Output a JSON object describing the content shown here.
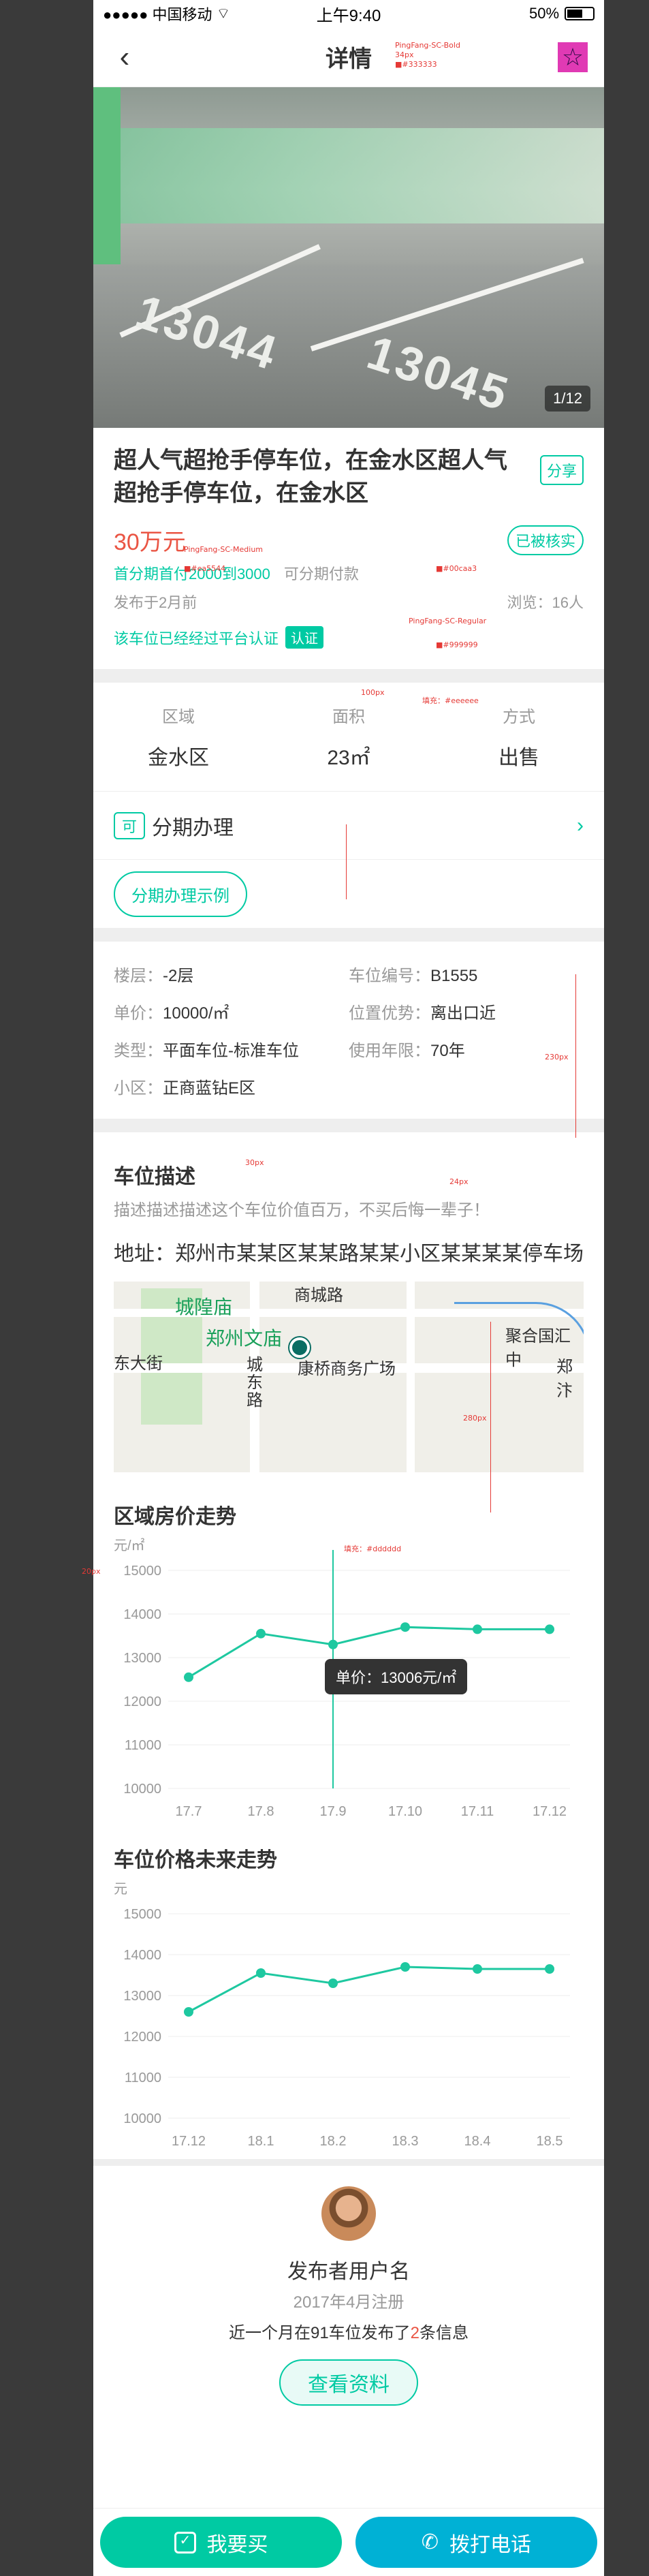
{
  "status_bar": {
    "carrier": "●●●●● 中国移动",
    "time": "上午9:40",
    "battery": "50%"
  },
  "nav": {
    "title": "详情"
  },
  "hero": {
    "counter": "1/12",
    "numbers": [
      "13044",
      "13045"
    ]
  },
  "listing": {
    "title": "超人气超抢手停车位，在金水区超人气超抢手停车位，在金水区",
    "share_label": "分享",
    "price": "30万元",
    "verified_label": "已被核实",
    "promo_installment": "首分期首付2000到3000",
    "promo_other": "可分期付款",
    "publish_time": "发布于2月前",
    "views": "浏览：16人",
    "auth_text": "该车位已经经过平台认证",
    "auth_badge": "认证"
  },
  "attrs": [
    {
      "label": "区域",
      "value": "金水区"
    },
    {
      "label": "面积",
      "value": "23㎡"
    },
    {
      "label": "方式",
      "value": "出售"
    }
  ],
  "installment": {
    "tag": "可",
    "label": "分期办理",
    "example": "分期办理示例"
  },
  "info": {
    "floor_k": "楼层：",
    "floor_v": "-2层",
    "code_k": "车位编号：",
    "code_v": "B1555",
    "unit_k": "单价：",
    "unit_v": "10000/㎡",
    "adv_k": "位置优势：",
    "adv_v": "离出口近",
    "type_k": "类型：",
    "type_v": "平面车位-标准车位",
    "years_k": "使用年限：",
    "years_v": "70年",
    "area_k": "小区：",
    "area_v": "正商蓝钻E区"
  },
  "description": {
    "title": "车位描述",
    "text": "描述描述描述这个车位价值百万，不买后悔一辈子！"
  },
  "address": {
    "label": "地址：",
    "value": "郑州市某某区某某路某某小区某某某某停车场"
  },
  "map": {
    "labels": [
      "商城路",
      "城隍庙",
      "郑州文庙",
      "东大街",
      "城东路",
      "聚合国汇中",
      "郑汴",
      "康桥商务广场"
    ]
  },
  "chart1": {
    "title": "区域房价走势"
  },
  "chart2": {
    "title": "车位价格未来走势"
  },
  "chart_data": [
    {
      "type": "line",
      "title": "区域房价走势",
      "ylabel": "元/㎡",
      "categories": [
        "17.7",
        "17.8",
        "17.9",
        "17.10",
        "17.11",
        "17.12"
      ],
      "values": [
        12550,
        13550,
        13300,
        13700,
        13650,
        13650
      ],
      "ylim": [
        10000,
        15000
      ],
      "yticks": [
        10000,
        11000,
        12000,
        13000,
        14000,
        15000
      ],
      "tooltip": "单价：13006元/㎡",
      "color": "#1ec8a0"
    },
    {
      "type": "line",
      "title": "车位价格未来走势",
      "ylabel": "元",
      "categories": [
        "17.12",
        "18.1",
        "18.2",
        "18.3",
        "18.4",
        "18.5"
      ],
      "values": [
        12600,
        13550,
        13300,
        13700,
        13650,
        13650
      ],
      "ylim": [
        10000,
        15000
      ],
      "yticks": [
        10000,
        11000,
        12000,
        13000,
        14000,
        15000
      ],
      "color": "#1ec8a0"
    }
  ],
  "publisher": {
    "name": "发布者用户名",
    "joined": "2017年4月注册",
    "stat_pre": "近一个月在91车位发布了",
    "stat_num": "2",
    "stat_post": "条信息",
    "view_btn": "查看资料"
  },
  "bottom": {
    "want": "我要买",
    "call": "拨打电话"
  },
  "colors": {
    "accent": "#00caa3",
    "price": "#ea5544",
    "call": "#00b1d5",
    "text": "#333333",
    "muted": "#999999"
  },
  "annotations": {
    "a1": "PingFang-SC-Bold",
    "a2": "34px",
    "a3": "■#333333",
    "a4": "PingFang-SC-Medium",
    "a5": "■#ea5544",
    "a6": "■#00caa3",
    "a7": "■#999999",
    "a8": "填充：#eeeeee",
    "a9": "填充：#dddddd",
    "a10": "PingFang-SC-Regular",
    "a11": "30px",
    "a12": "24px",
    "a13": "100px",
    "a14": "230px",
    "a15": "280px",
    "a16": "20px"
  }
}
